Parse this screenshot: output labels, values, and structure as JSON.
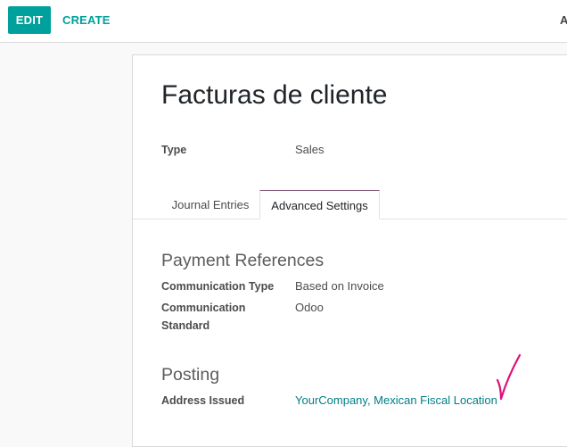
{
  "toolbar": {
    "edit_label": "EDIT",
    "create_label": "CREATE",
    "cut_text": "A"
  },
  "record": {
    "title": "Facturas de cliente"
  },
  "fields": {
    "type_label": "Type",
    "type_value": "Sales"
  },
  "tabs": [
    {
      "label": "Journal Entries",
      "active": false
    },
    {
      "label": "Advanced Settings",
      "active": true
    }
  ],
  "payment_references": {
    "heading": "Payment References",
    "communication_type_label": "Communication Type",
    "communication_type_value": "Based on Invoice",
    "communication_standard_label_1": "Communication",
    "communication_standard_label_2": "Standard",
    "communication_standard_value": "Odoo"
  },
  "posting": {
    "heading": "Posting",
    "address_issued_label": "Address Issued",
    "address_issued_value": "YourCompany, Mexican Fiscal Location"
  },
  "annotation": {
    "icon": "checkmark-icon",
    "color": "#e0107a"
  },
  "colors": {
    "primary": "#00a09d",
    "link": "#017e84",
    "tab_accent": "#875a7b"
  }
}
